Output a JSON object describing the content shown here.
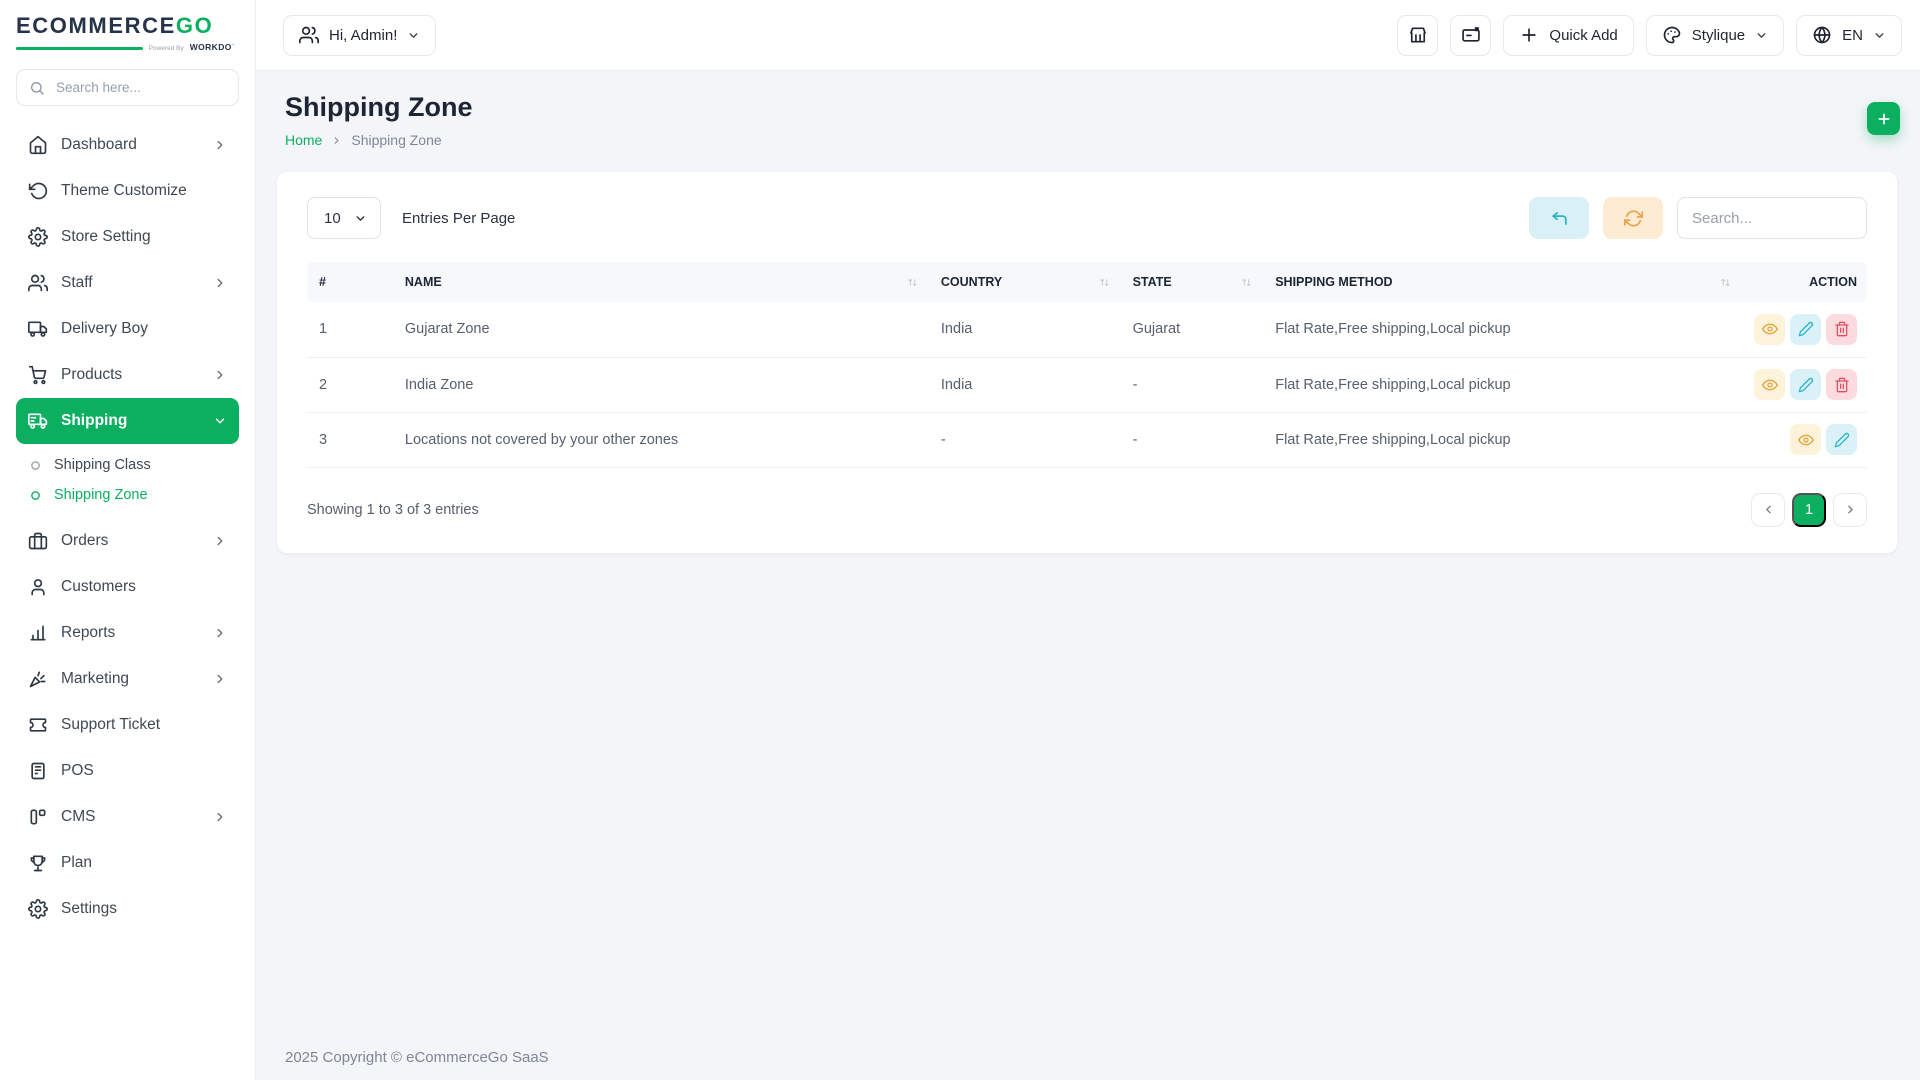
{
  "brand": {
    "name_primary": "ECOMMERCE",
    "name_secondary": "GO",
    "powered_by": "Powered By",
    "powered_brand": "WORKDO"
  },
  "colors": {
    "primary_green": "#0caf60",
    "navy": "#263349",
    "view_accent": "#e6a43f",
    "edit_accent": "#2ab5cb",
    "delete_accent": "#e25160"
  },
  "topbar": {
    "greeting": "Hi, Admin!",
    "quick_add": "Quick Add",
    "theme_name": "Stylique",
    "language": "EN"
  },
  "sidebar": {
    "search_placeholder": "Search here...",
    "items": [
      {
        "label": "Dashboard"
      },
      {
        "label": "Theme Customize"
      },
      {
        "label": "Store Setting"
      },
      {
        "label": "Staff"
      },
      {
        "label": "Delivery Boy"
      },
      {
        "label": "Products"
      },
      {
        "label": "Shipping"
      },
      {
        "label": "Shipping Class"
      },
      {
        "label": "Shipping Zone"
      },
      {
        "label": "Orders"
      },
      {
        "label": "Customers"
      },
      {
        "label": "Reports"
      },
      {
        "label": "Marketing"
      },
      {
        "label": "Support Ticket"
      },
      {
        "label": "POS"
      },
      {
        "label": "CMS"
      },
      {
        "label": "Plan"
      },
      {
        "label": "Settings"
      }
    ]
  },
  "page": {
    "title": "Shipping Zone",
    "breadcrumb_home": "Home",
    "breadcrumb_current": "Shipping Zone"
  },
  "controls": {
    "entries_value": "10",
    "entries_label": "Entries Per Page",
    "search_placeholder": "Search..."
  },
  "table": {
    "headers": {
      "index": "#",
      "name": "NAME",
      "country": "COUNTRY",
      "state": "STATE",
      "shipping_method": "SHIPPING METHOD",
      "action": "ACTION"
    },
    "rows": [
      {
        "index": "1",
        "name": "Gujarat Zone",
        "country": "India",
        "state": "Gujarat",
        "shipping_method": "Flat Rate,Free shipping,Local pickup"
      },
      {
        "index": "2",
        "name": "India Zone",
        "country": "India",
        "state": "-",
        "shipping_method": "Flat Rate,Free shipping,Local pickup"
      },
      {
        "index": "3",
        "name": "Locations not covered by your other zones",
        "country": "-",
        "state": "-",
        "shipping_method": "Flat Rate,Free shipping,Local pickup"
      }
    ]
  },
  "pagination": {
    "summary": "Showing 1 to 3 of 3 entries",
    "current_page": "1"
  },
  "footer": {
    "copyright": "2025 Copyright © eCommerceGo SaaS"
  }
}
